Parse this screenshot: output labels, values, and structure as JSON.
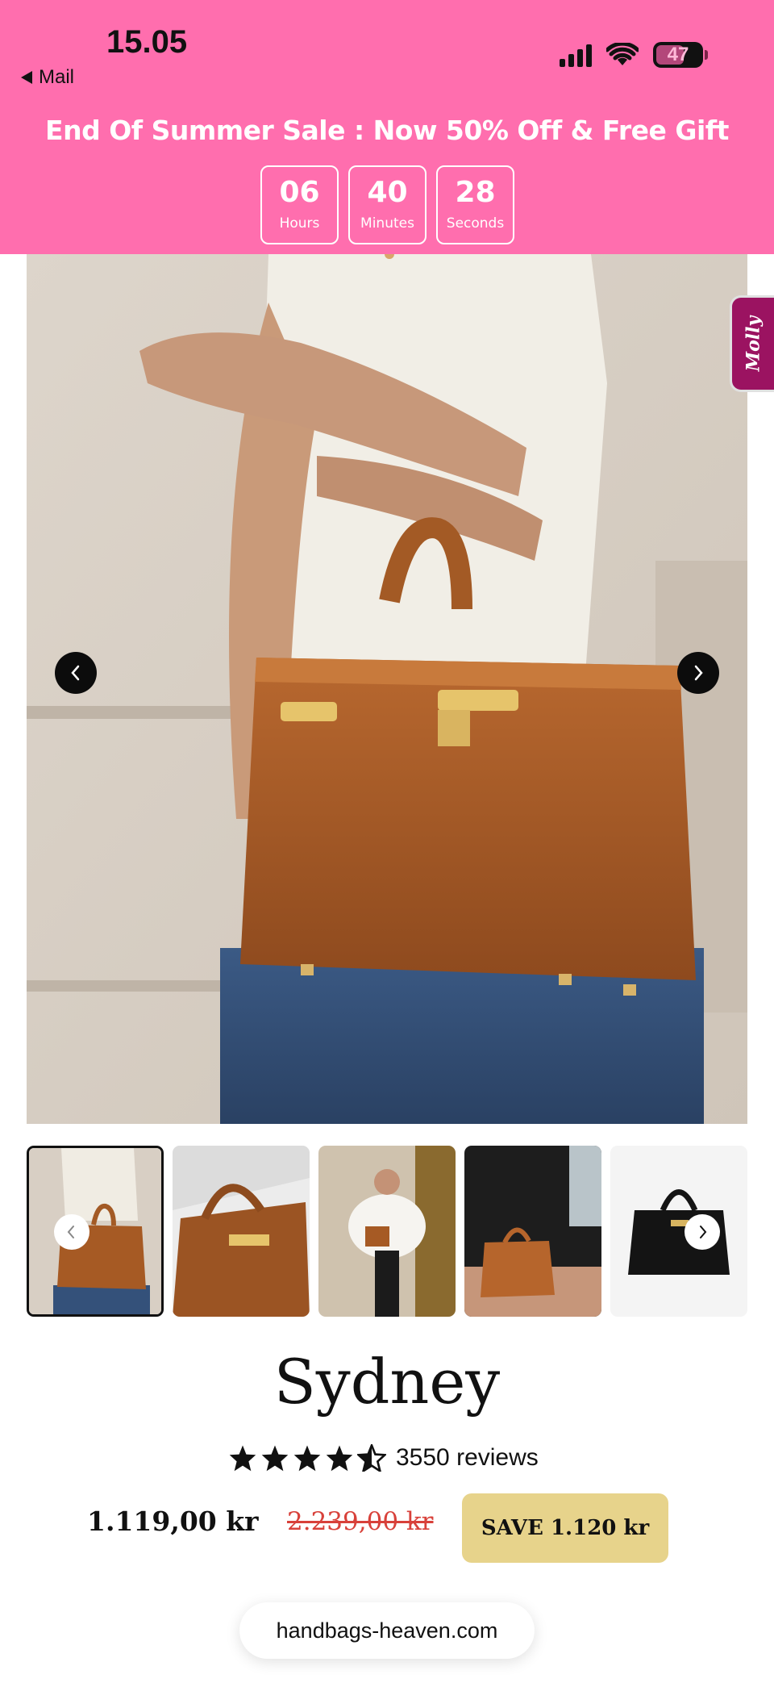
{
  "status_bar": {
    "time": "15.05",
    "back_label": "Mail",
    "battery": "47"
  },
  "promo": {
    "text": "End Of Summer Sale : Now 50% Off & Free Gift",
    "countdown": [
      {
        "value": "06",
        "label": "Hours"
      },
      {
        "value": "40",
        "label": "Minutes"
      },
      {
        "value": "28",
        "label": "Seconds"
      }
    ]
  },
  "side_tab": {
    "label": "Molly"
  },
  "product": {
    "title": "Sydney",
    "rating": 4.5,
    "reviews": "3550 reviews",
    "price": "1.119,00 kr",
    "old_price": "2.239,00 kr",
    "save": "SAVE 1.120 kr"
  },
  "gallery": {
    "thumbnails": [
      {
        "name": "thumb-brown-bag-held"
      },
      {
        "name": "thumb-brown-bag-closeup"
      },
      {
        "name": "thumb-woman-white-fur"
      },
      {
        "name": "thumb-bag-black-dress"
      },
      {
        "name": "thumb-black-bag"
      }
    ]
  },
  "browser": {
    "url": "handbags-heaven.com"
  },
  "colors": {
    "header": "#ff6eae",
    "save_badge": "#e7d38b",
    "old_price": "#d8413a"
  }
}
